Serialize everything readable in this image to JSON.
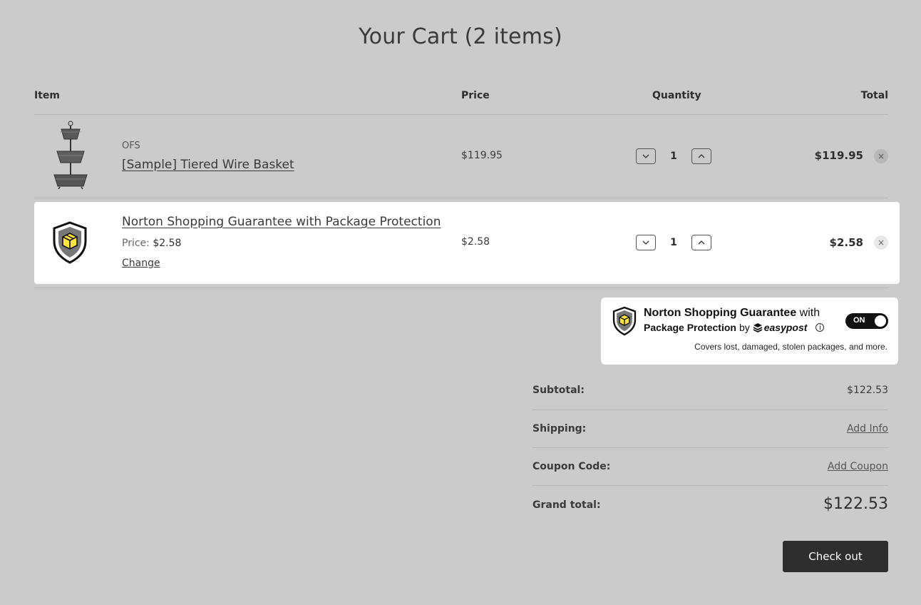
{
  "cart": {
    "title": "Your Cart (2 items)"
  },
  "table": {
    "headers": {
      "item": "Item",
      "price": "Price",
      "quantity": "Quantity",
      "total": "Total"
    },
    "items": [
      {
        "brand": "OFS",
        "name": "[Sample] Tiered Wire Basket",
        "price": "$119.95",
        "quantity": "1",
        "total": "$119.95",
        "remove": "×"
      },
      {
        "name": "Norton Shopping Guarantee with Package Protection",
        "price_label": "Price:",
        "price_value": "$2.58",
        "change": "Change",
        "price": "$2.58",
        "quantity": "1",
        "total": "$2.58",
        "remove": "×"
      }
    ]
  },
  "norton_card": {
    "title_bold": "Norton Shopping Guarantee",
    "title_rest": " with",
    "sub_bold": "Package Protection",
    "sub_by": "by",
    "easypost": "easypost",
    "toggle": "ON",
    "covers": "Covers lost, damaged, stolen packages, and more."
  },
  "summary": {
    "subtotal_label": "Subtotal:",
    "subtotal_value": "$122.53",
    "shipping_label": "Shipping:",
    "shipping_value": "Add Info",
    "coupon_label": "Coupon Code:",
    "coupon_value": "Add Coupon",
    "grand_label": "Grand total:",
    "grand_value": "$122.53"
  },
  "checkout": {
    "label": "Check out"
  },
  "icons": {
    "qty_down": "chevron-down-icon",
    "qty_up": "chevron-up-icon",
    "remove": "close-icon",
    "info": "info-icon"
  }
}
